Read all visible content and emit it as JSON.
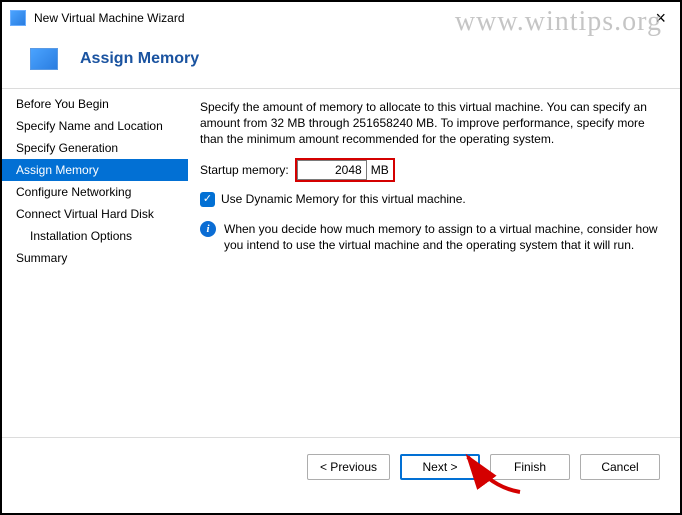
{
  "watermark": "www.wintips.org",
  "window": {
    "title": "New Virtual Machine Wizard"
  },
  "header": {
    "title": "Assign Memory"
  },
  "sidebar": {
    "items": [
      {
        "label": "Before You Begin"
      },
      {
        "label": "Specify Name and Location"
      },
      {
        "label": "Specify Generation"
      },
      {
        "label": "Assign Memory"
      },
      {
        "label": "Configure Networking"
      },
      {
        "label": "Connect Virtual Hard Disk"
      },
      {
        "label": "Installation Options"
      },
      {
        "label": "Summary"
      }
    ],
    "selected_index": 3
  },
  "content": {
    "description": "Specify the amount of memory to allocate to this virtual machine. You can specify an amount from 32 MB through 251658240 MB. To improve performance, specify more than the minimum amount recommended for the operating system.",
    "startup_label": "Startup memory:",
    "startup_value": "2048",
    "startup_unit": "MB",
    "dynamic_checkbox_label": "Use Dynamic Memory for this virtual machine.",
    "dynamic_checked": true,
    "info_text": "When you decide how much memory to assign to a virtual machine, consider how you intend to use the virtual machine and the operating system that it will run."
  },
  "buttons": {
    "previous": "< Previous",
    "next": "Next >",
    "finish": "Finish",
    "cancel": "Cancel"
  },
  "annotation": {
    "highlight_color": "#d40000"
  }
}
